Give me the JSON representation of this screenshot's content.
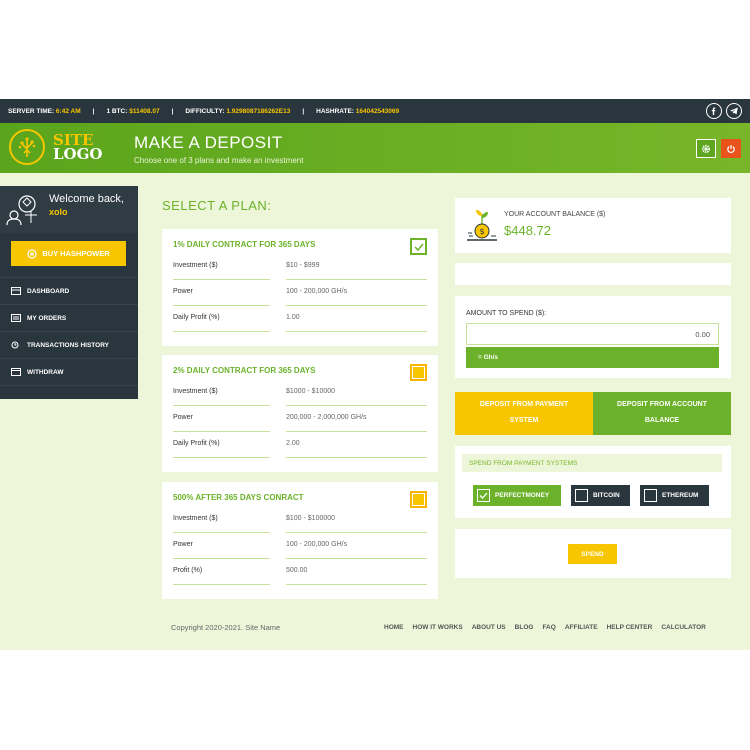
{
  "topbar": {
    "server_time_label": "SERVER TIME:",
    "server_time_value": "6:42 AM",
    "btc_label": "1 BTC:",
    "btc_value": "$11408.07",
    "difficulty_label": "DIFFICULTY:",
    "difficulty_value": "1.9298087186262E13",
    "hashrate_label": "HASHRATE:",
    "hashrate_value": "164042543069",
    "separator": "|",
    "social": [
      {
        "icon": "facebook-icon",
        "glyph": "f"
      },
      {
        "icon": "telegram-icon",
        "glyph": "➤"
      }
    ]
  },
  "header": {
    "logo_line1": "SITE",
    "logo_line2": "LOGO",
    "title": "MAKE A DEPOSIT",
    "subtitle": "Choose one of 3 plans and make an investment"
  },
  "sidebar": {
    "welcome": "Welcome back,",
    "username": "xolo",
    "buy_label": "BUY HASHPOWER",
    "items": [
      {
        "label": "DASHBOARD",
        "icon": "dashboard-icon"
      },
      {
        "label": "MY ORDERS",
        "icon": "orders-icon"
      },
      {
        "label": "TRANSACTIONS HISTORY",
        "icon": "history-icon"
      },
      {
        "label": "WITHDRAW",
        "icon": "withdraw-icon"
      }
    ]
  },
  "plans": {
    "heading": "SELECT A PLAN:",
    "list": [
      {
        "title": "1% DAILY CONTRACT FOR 365 DAYS",
        "selected": true,
        "rows": [
          {
            "label": "Investment ($)",
            "value": "$10 - $999"
          },
          {
            "label": "Power",
            "value": "100 - 200,000 GH/s"
          },
          {
            "label": "Daily Profit (%)",
            "value": "1.00"
          }
        ]
      },
      {
        "title": "2% DAILY CONTRACT FOR 365 DAYS",
        "selected": false,
        "rows": [
          {
            "label": "Investment ($)",
            "value": "$1000 - $10000"
          },
          {
            "label": "Power",
            "value": "200,000 - 2,000,000 GH/s"
          },
          {
            "label": "Daily Profit (%)",
            "value": "2.00"
          }
        ]
      },
      {
        "title": "500% AFTER 365 DAYS CONRACT",
        "selected": false,
        "rows": [
          {
            "label": "Investment ($)",
            "value": "$100 - $100000"
          },
          {
            "label": "Power",
            "value": "100 - 200,000 GH/s"
          },
          {
            "label": "Profit (%)",
            "value": "500.00"
          }
        ]
      }
    ]
  },
  "balance": {
    "label": "YOUR ACCOUNT BALANCE ($)",
    "value": "$448.72"
  },
  "amount": {
    "label": "AMOUNT TO SPEND ($):",
    "value": "0.00",
    "ghs": "= Gh/s"
  },
  "tabs": {
    "payment_line1": "DEPOSIT FROM PAYMENT",
    "payment_line2": "SYSTEM",
    "account_line1": "DEPOSIT FROM ACCOUNT",
    "account_line2": "BALANCE"
  },
  "spend_from": {
    "heading": "SPEND FROM PAYMENT SYSTEMS",
    "options": [
      {
        "label": "PERFECTMONEY",
        "checked": true
      },
      {
        "label": "BITCOIN",
        "checked": false
      },
      {
        "label": "ETHEREUM",
        "checked": false
      }
    ]
  },
  "spend_button": "SPEND",
  "footer": {
    "copyright": "Copyright 2020-2021. Site Name",
    "nav": [
      "HOME",
      "HOW IT WORKS",
      "ABOUT US",
      "BLOG",
      "FAQ",
      "AFFILIATE",
      "HELP CENTER",
      "CALCULATOR"
    ]
  },
  "colors": {
    "green": "#6bb22a",
    "yellow": "#f7c600",
    "dark": "#2a363d",
    "red": "#e9541c",
    "background": "#eef6d9"
  }
}
